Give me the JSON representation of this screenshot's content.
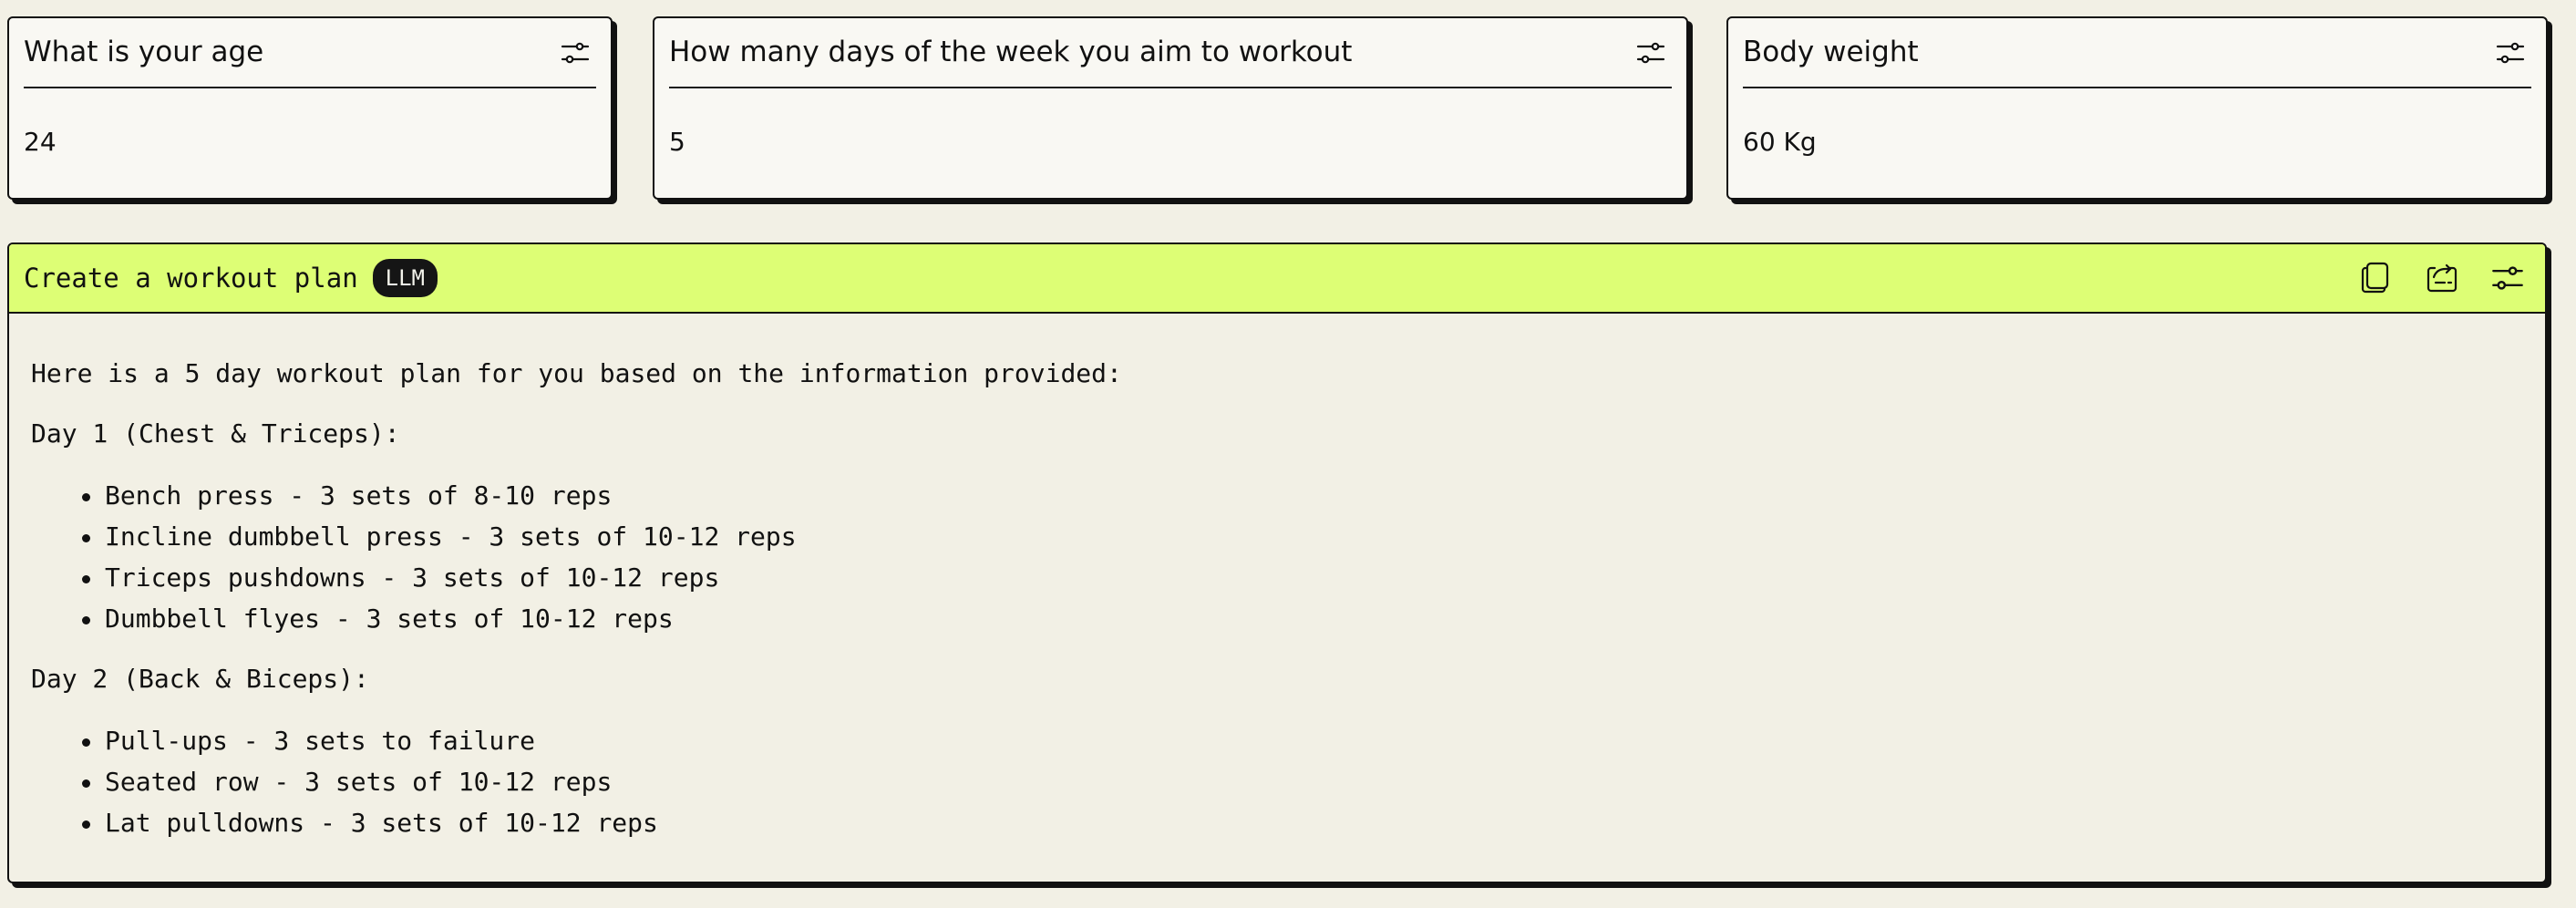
{
  "cards": [
    {
      "title": "What is your age",
      "value": "24"
    },
    {
      "title": "How many days of the week you aim to workout",
      "value": "5"
    },
    {
      "title": "Body weight",
      "value": "60 Kg"
    }
  ],
  "plan": {
    "title": "Create a workout plan",
    "badge": "LLM",
    "intro": "Here is a 5 day workout plan for you based on the information provided:",
    "days": [
      {
        "label": "Day 1 (Chest & Triceps):",
        "exercises": [
          "Bench press - 3 sets of 8-10 reps",
          "Incline dumbbell press - 3 sets of 10-12 reps",
          "Triceps pushdowns - 3 sets of 10-12 reps",
          "Dumbbell flyes - 3 sets of 10-12 reps"
        ]
      },
      {
        "label": "Day 2 (Back & Biceps):",
        "exercises": [
          "Pull-ups - 3 sets to failure",
          "Seated row - 3 sets of 10-12 reps",
          "Lat pulldowns - 3 sets of 10-12 reps"
        ]
      }
    ]
  },
  "icons": {
    "settings": "sliders-icon",
    "copy": "copy-icon",
    "export": "export-icon"
  },
  "colors": {
    "page_background": "#f2f0e5",
    "card_background": "#f9f8f3",
    "accent_header": "#ddfe75",
    "badge_background": "#151515",
    "text": "#111111"
  }
}
